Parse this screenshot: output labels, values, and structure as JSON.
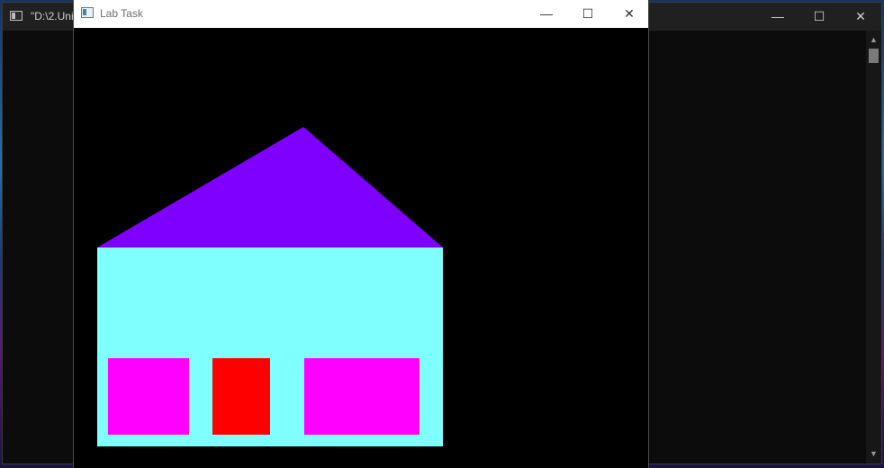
{
  "background_window": {
    "title": "\"D:\\2.Uni",
    "minimize_glyph": "—",
    "maximize_glyph": "☐",
    "close_glyph": "✕",
    "scroll_up_glyph": "▲",
    "scroll_down_glyph": "▼"
  },
  "lab_window": {
    "title": "Lab Task",
    "minimize_glyph": "—",
    "maximize_glyph": "☐",
    "close_glyph": "✕"
  },
  "scene": {
    "background_color": "#000000",
    "roof_color": "#7f00ff",
    "wall_color": "#80ffff",
    "left_window_color": "#ff00ff",
    "door_color": "#ff0000",
    "right_window_color": "#ff00ff"
  }
}
